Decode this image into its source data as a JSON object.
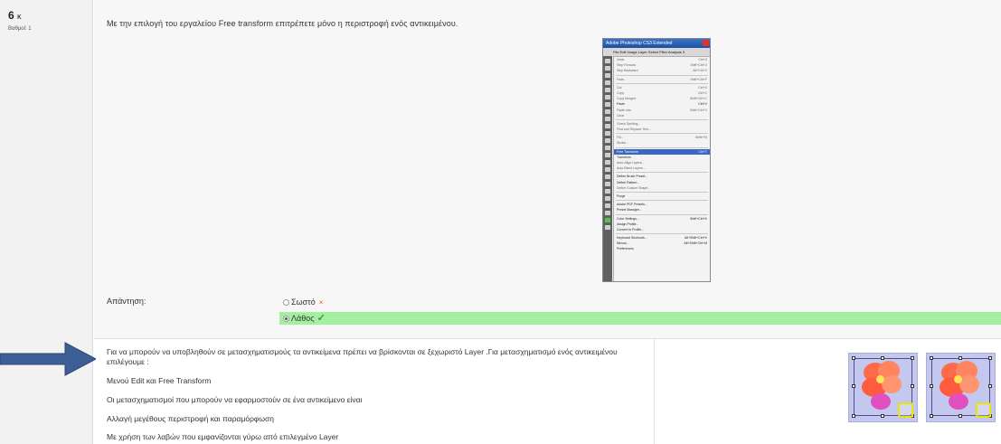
{
  "question": {
    "number": "6",
    "number_suffix": "κ",
    "grade": "Βαθμοί: 1",
    "text": "Με την επιλογή του εργαλείου Free transform επιτρέπετε μόνο η περιστροφή ενός αντικειμένου."
  },
  "screenshot": {
    "window_title": "Adobe Photoshop CS3 Extended",
    "menubar": "File  Edit  Image  Layer  Select  Filter  Analysis  3",
    "menu_items": [
      {
        "label": "Undo",
        "shortcut": "Ctrl+Z"
      },
      {
        "label": "Step Forward",
        "shortcut": "Shift+Ctrl+Z"
      },
      {
        "label": "Step Backward",
        "shortcut": "Alt+Ctrl+Z"
      },
      {
        "sep": true
      },
      {
        "label": "Fade...",
        "shortcut": "Shift+Ctrl+F"
      },
      {
        "sep": true
      },
      {
        "label": "Cut",
        "shortcut": "Ctrl+X"
      },
      {
        "label": "Copy",
        "shortcut": "Ctrl+C"
      },
      {
        "label": "Copy Merged",
        "shortcut": "Shift+Ctrl+C"
      },
      {
        "label": "Paste",
        "shortcut": "Ctrl+V",
        "dark": true
      },
      {
        "label": "Paste Into",
        "shortcut": "Shift+Ctrl+V"
      },
      {
        "label": "Clear",
        "shortcut": ""
      },
      {
        "sep": true
      },
      {
        "label": "Check Spelling...",
        "shortcut": ""
      },
      {
        "label": "Find and Replace Text...",
        "shortcut": ""
      },
      {
        "sep": true
      },
      {
        "label": "Fill...",
        "shortcut": "Shift+F5"
      },
      {
        "label": "Stroke...",
        "shortcut": ""
      },
      {
        "sep": true
      },
      {
        "label": "Free Transform",
        "shortcut": "Ctrl+T",
        "highlight": true
      },
      {
        "label": "Transform",
        "shortcut": "",
        "dark": true
      },
      {
        "label": "Auto-Align Layers...",
        "shortcut": ""
      },
      {
        "label": "Auto-Blend Layers...",
        "shortcut": ""
      },
      {
        "sep": true
      },
      {
        "label": "Define Brush Preset...",
        "shortcut": "",
        "dark": true
      },
      {
        "label": "Define Pattern...",
        "shortcut": "",
        "dark": true
      },
      {
        "label": "Define Custom Shape...",
        "shortcut": ""
      },
      {
        "sep": true
      },
      {
        "label": "Purge",
        "shortcut": "",
        "dark": true
      },
      {
        "sep": true
      },
      {
        "label": "Adobe PDF Presets...",
        "shortcut": "",
        "dark": true
      },
      {
        "label": "Preset Manager...",
        "shortcut": "",
        "dark": true
      },
      {
        "sep": true
      },
      {
        "label": "Color Settings...",
        "shortcut": "Shift+Ctrl+K",
        "dark": true
      },
      {
        "label": "Assign Profile...",
        "shortcut": "",
        "dark": true
      },
      {
        "label": "Convert to Profile...",
        "shortcut": "",
        "dark": true
      },
      {
        "sep": true
      },
      {
        "label": "Keyboard Shortcuts...",
        "shortcut": "Alt+Shift+Ctrl+K",
        "dark": true
      },
      {
        "label": "Menus...",
        "shortcut": "Alt+Shift+Ctrl+M",
        "dark": true
      },
      {
        "label": "Preferences",
        "shortcut": "",
        "dark": true
      }
    ]
  },
  "answer": {
    "label": "Απάντηση:",
    "option_true": "Σωστό",
    "option_false": "Λάθος",
    "wrong_mark": "×",
    "correct_mark": "✓"
  },
  "feedback": {
    "intro": "Για να μπορούν να υποβληθούν σε μετασχηματισμούς τα αντικείμενα πρέπει να βρίσκονται σε ξεχωριστό Layer .Για μετασχηματισμό ενός αντικειμένου επιλέγουμε :",
    "line1": "Μενού Edit και Free Transform",
    "line2": "Οι μετασχηματισμοί που μπορούν να εφαρμοστούν σε ένα αντικείμενο είναι",
    "line3": "Αλλαγή μεγέθους περιστροφή και παραμόρφωση",
    "line4": "Με χρήση των λαβών που εμφανίζονται γύρω από επιλεγμένο Layer"
  },
  "colors": {
    "correct_bg": "#a3f0a0",
    "arrow": "#3e5f96",
    "highlight_box": "#e7e600"
  }
}
